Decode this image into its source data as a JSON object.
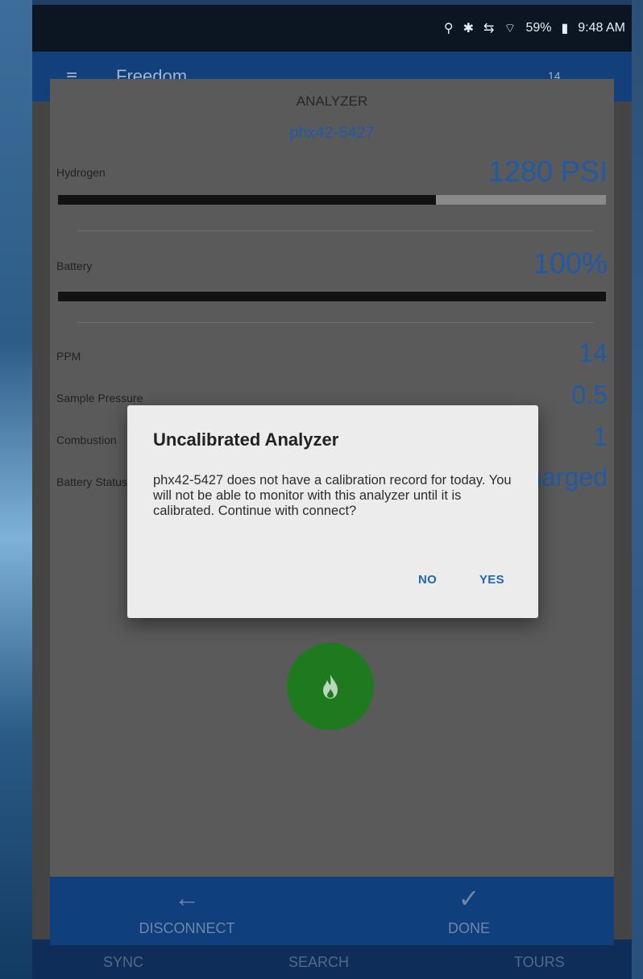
{
  "status_bar": {
    "battery": "59%",
    "time": "9:48 AM"
  },
  "app_bar": {
    "title": "Freedom",
    "count": "14"
  },
  "bottom_nav": [
    "SYNC",
    "SEARCH",
    "TOURS"
  ],
  "analyzer": {
    "title": "ANALYZER",
    "device_id": "phx42-5427",
    "hydrogen": {
      "label": "Hydrogen",
      "value": "1280 PSI",
      "level": 0.69
    },
    "battery": {
      "label": "Battery",
      "value": "100%",
      "level": 1.0
    },
    "ppm": {
      "label": "PPM",
      "value": "14"
    },
    "sample_pressure": {
      "label": "Sample Pressure",
      "value": "0.5"
    },
    "combustion": {
      "label": "Combustion",
      "value": "1"
    },
    "battery_status": {
      "label": "Battery Status",
      "value": "Charged"
    }
  },
  "actions": {
    "disconnect": "DISCONNECT",
    "done": "DONE"
  },
  "dialog": {
    "title": "Uncalibrated Analyzer",
    "message": "phx42-5427 does not have a calibration record for today. You will not be able to monitor with this analyzer until it is calibrated. Continue with connect?",
    "no": "NO",
    "yes": "YES"
  },
  "colors": {
    "accent": "#1f5aa8",
    "app_bar": "#133f7a",
    "fab": "#1f7a1f",
    "dialog_button": "#2267b3"
  }
}
